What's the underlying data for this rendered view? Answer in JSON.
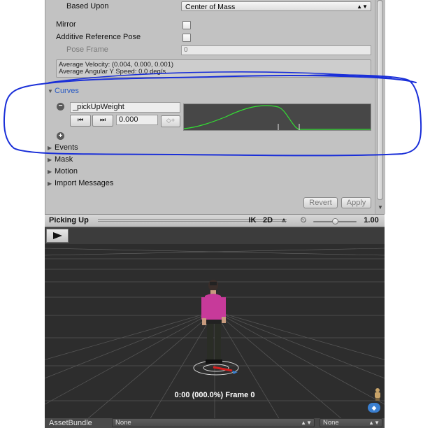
{
  "inspector": {
    "based_upon_label": "Based Upon",
    "based_upon_value": "Center of Mass",
    "mirror_label": "Mirror",
    "additive_label": "Additive Reference Pose",
    "pose_frame_label": "Pose Frame",
    "pose_frame_value": "0",
    "average_velocity": "Average Velocity: (0.004, 0.000, 0.001)",
    "average_angular": "Average Angular Y Speed: 0.0 deg/s",
    "curves_label": "Curves",
    "curve_name": "_pickUpWeight",
    "curve_value": "0.000",
    "events_label": "Events",
    "mask_label": "Mask",
    "motion_label": "Motion",
    "import_messages_label": "Import Messages",
    "revert_label": "Revert",
    "apply_label": "Apply"
  },
  "preview": {
    "title": "Picking Up",
    "ik_label": "IK",
    "mode_2d_label": "2D",
    "speed_value": "1.00",
    "speed_fraction": 0.5,
    "frame_readout": "0:00 (000.0%) Frame 0"
  },
  "asset_bundle": {
    "label": "AssetBundle",
    "bundle_value": "None",
    "variant_value": "None"
  },
  "colors": {
    "annotation_pen": "#1a2fd8",
    "curve_line": "#33e033",
    "curves_foldout": "#2a5bc4"
  },
  "icons": {
    "remove": "minus-circle-icon",
    "add": "plus-circle-icon",
    "prev_key": "previous-key-icon",
    "next_key": "next-key-icon",
    "add_key": "add-key-icon",
    "play": "play-icon",
    "pivot": "pivot-icon",
    "speed": "speed-icon",
    "tag": "tag-icon"
  }
}
